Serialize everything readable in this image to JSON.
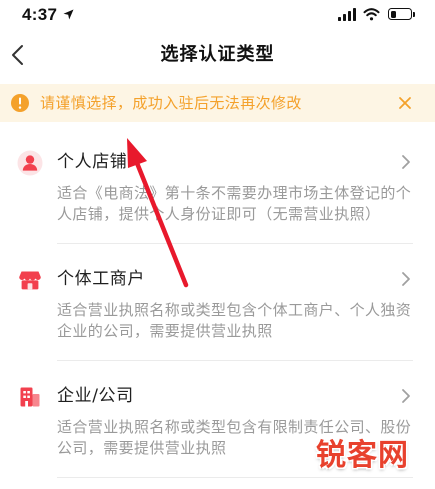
{
  "status_bar": {
    "time": "4:37",
    "battery_level": 0.3
  },
  "nav": {
    "back_icon": "chevron-left-icon",
    "title": "选择认证类型"
  },
  "notice": {
    "icon": "warning-icon",
    "text": "请谨慎选择，成功入驻后无法再次修改",
    "close_icon": "close-icon"
  },
  "options": [
    {
      "icon": "person-icon",
      "title": "个人店铺",
      "desc": "适合《电商法》第十条不需要办理市场主体登记的个人店铺，提供个人身份证即可（无需营业执照）"
    },
    {
      "icon": "shop-icon",
      "title": "个体工商户",
      "desc": "适合营业执照名称或类型包含个体工商户、个人独资企业的公司，需要提供营业执照"
    },
    {
      "icon": "building-icon",
      "title": "企业/公司",
      "desc": "适合营业执照名称或类型包含有限制责任公司、股份公司，需要提供营业执照"
    }
  ],
  "watermark": {
    "text": "锐客网"
  },
  "colors": {
    "accent": "#F2404E",
    "accent_soft": "#FCE4E6",
    "notice_bg": "#FDF5E4",
    "notice_text": "#F4A12B",
    "title": "#1F1F1F",
    "desc": "#9A9A9A",
    "divider": "#EBEBEB",
    "annotation": "#E8192C",
    "watermark": "#E8412D"
  }
}
